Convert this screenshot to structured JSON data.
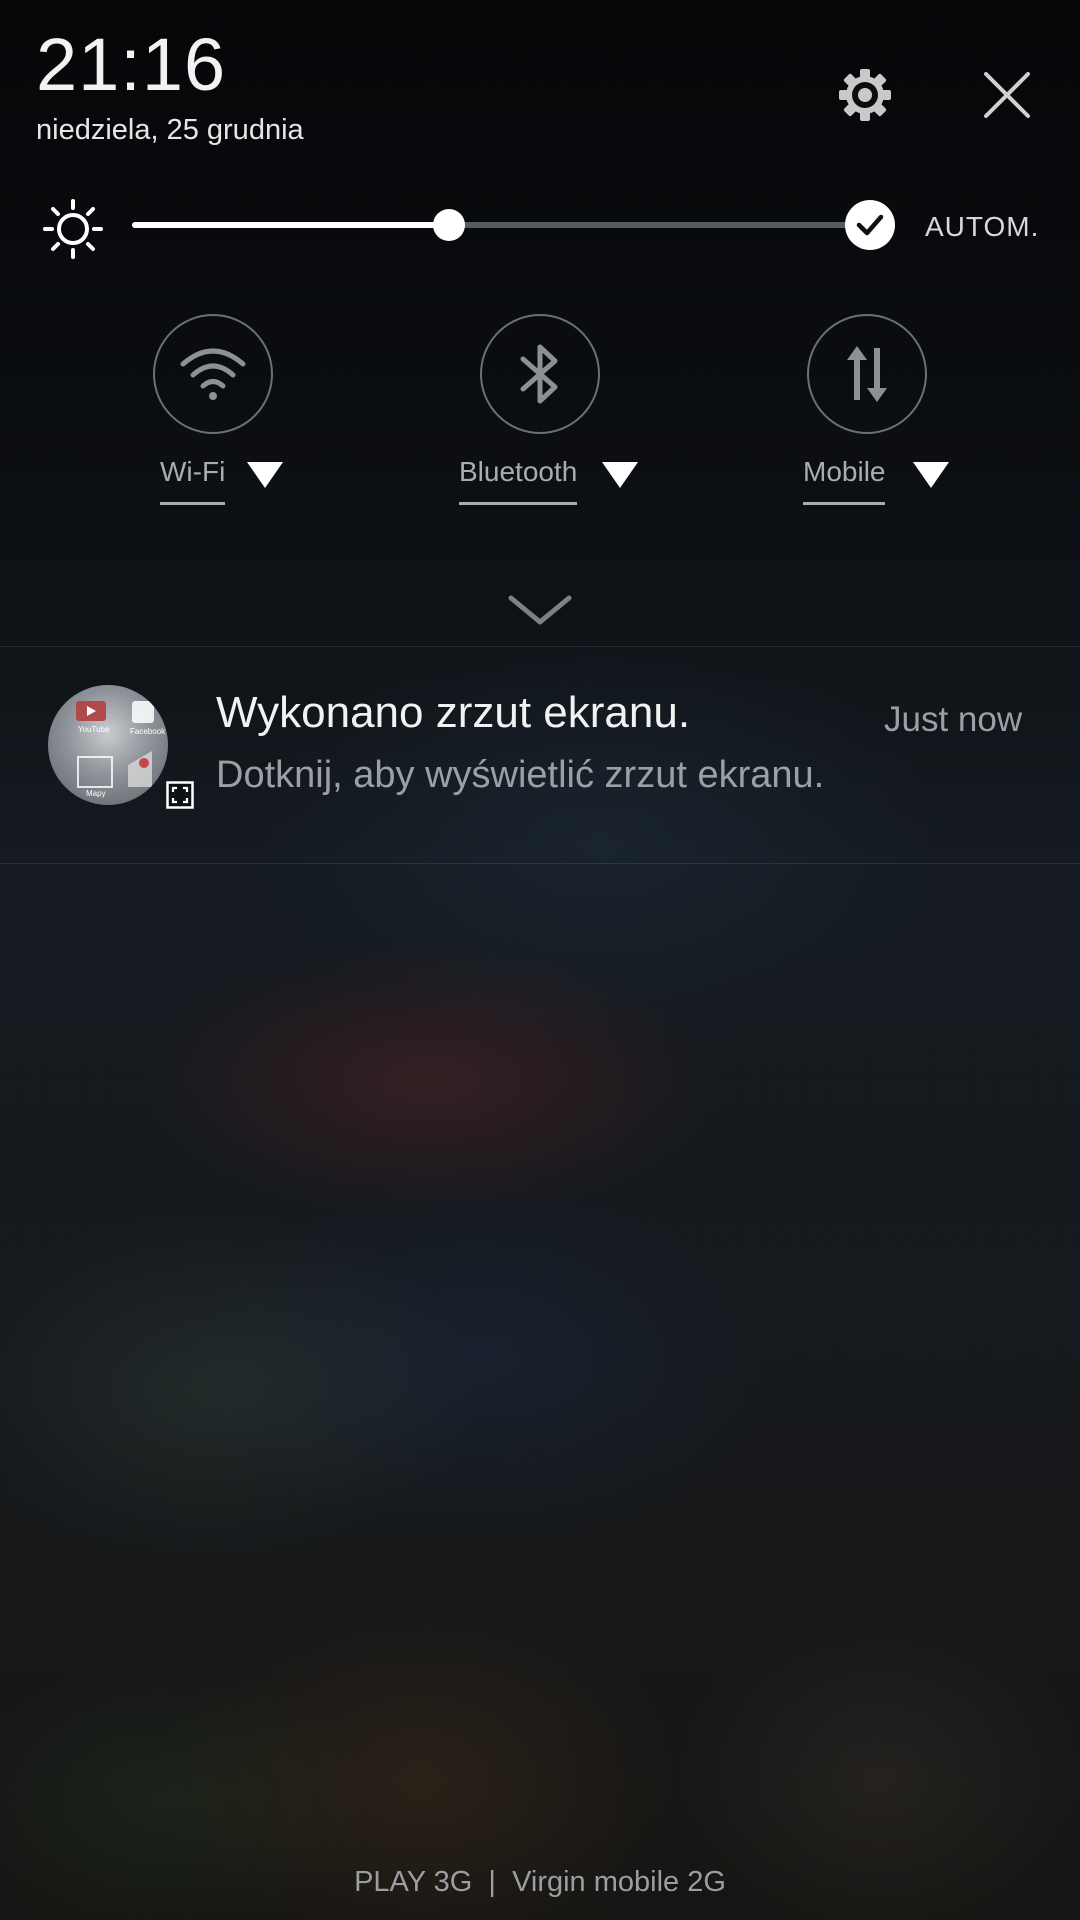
{
  "header": {
    "time": "21:16",
    "date": "niedziela, 25 grudnia"
  },
  "icons": {
    "settings": "gear-icon",
    "close": "close-icon",
    "brightness": "sun-icon",
    "auto_check": "check-icon",
    "expand": "chevron-down-icon"
  },
  "brightness": {
    "level": 0.43,
    "auto_label": "AUTOM.",
    "auto_enabled": true
  },
  "toggles": [
    {
      "label": "Wi-Fi",
      "icon": "wifi-icon"
    },
    {
      "label": "Bluetooth",
      "icon": "bluetooth-icon"
    },
    {
      "label": "Mobile",
      "icon": "mobile-data-icon"
    }
  ],
  "notification": {
    "title": "Wykonano zrzut ekranu.",
    "time": "Just now",
    "body": "Dotknij, aby wyświetlić zrzut ekranu.",
    "thumb_labels": [
      "YouTube",
      "Facebook",
      "Mapy"
    ]
  },
  "footer": {
    "carrier": "PLAY 3G  |  Virgin mobile 2G"
  }
}
